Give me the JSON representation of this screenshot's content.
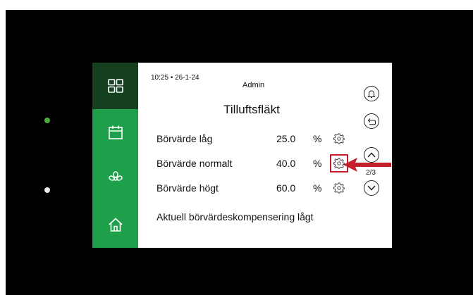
{
  "header": {
    "time": "10:25",
    "separator": "•",
    "date": "26-1-24",
    "user": "Admin"
  },
  "title": "Tilluftsfläkt",
  "rows": [
    {
      "label": "Börvärde låg",
      "value": "25.0",
      "unit": "%",
      "highlighted": false
    },
    {
      "label": "Börvärde normalt",
      "value": "40.0",
      "unit": "%",
      "highlighted": true
    },
    {
      "label": "Börvärde högt",
      "value": "60.0",
      "unit": "%",
      "highlighted": false
    }
  ],
  "info_text": "Aktuell börvärdeskompensering lågt",
  "pagination": "2/3",
  "sidebar": {
    "items": [
      {
        "icon": "dashboard-grid-icon",
        "active": true
      },
      {
        "icon": "calendar-icon",
        "active": false
      },
      {
        "icon": "fan-icon",
        "active": false
      },
      {
        "icon": "home-icon",
        "active": false
      }
    ]
  },
  "right_buttons": [
    "bell-icon",
    "back-icon",
    "chevron-up-icon",
    "chevron-down-icon"
  ],
  "colors": {
    "sidebar": "#1ea04a",
    "sidebar_active": "#14401f",
    "highlight": "#c41e2a",
    "bezel": "#000000"
  }
}
